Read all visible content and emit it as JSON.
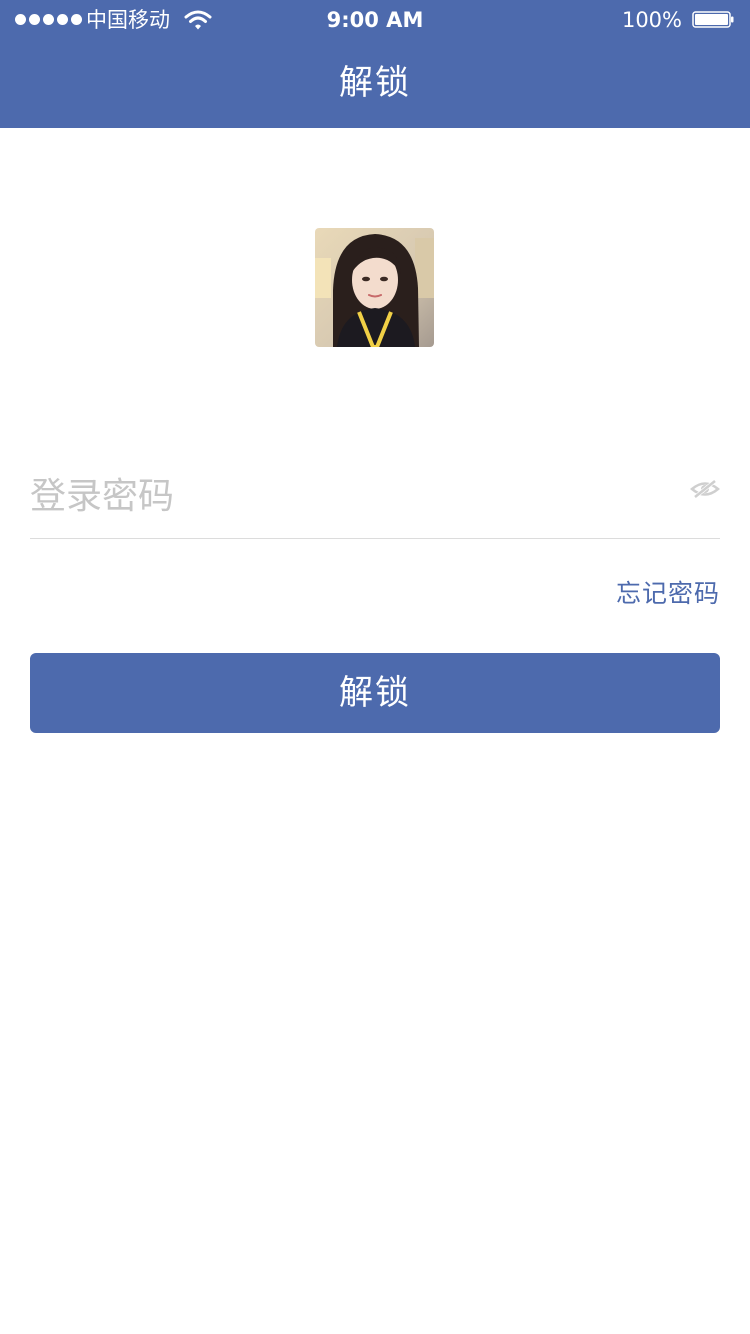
{
  "status_bar": {
    "carrier": "中国移动",
    "time": "9:00 AM",
    "battery": "100%"
  },
  "nav": {
    "title": "解锁"
  },
  "avatar": {
    "icon": "user-avatar-photo"
  },
  "password": {
    "value": "",
    "placeholder": "登录密码",
    "toggle_icon": "eye-hidden-icon"
  },
  "forgot_password": "忘记密码",
  "unlock_button": "解锁",
  "colors": {
    "primary": "#4d6aad",
    "placeholder": "#c6c6c6",
    "divider": "#dcdcdc",
    "background": "#ffffff"
  }
}
